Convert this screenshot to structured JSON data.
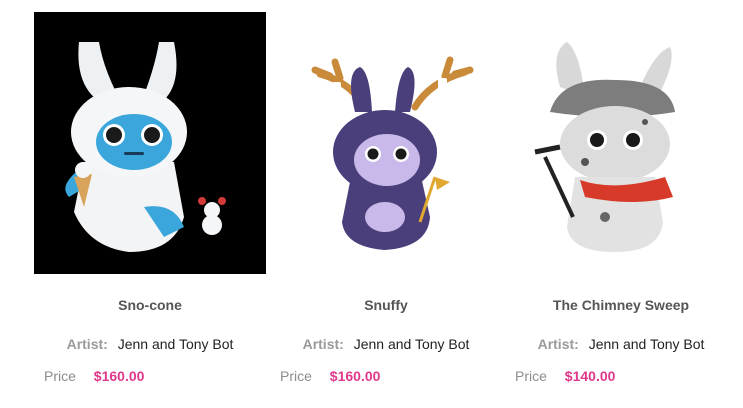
{
  "products": [
    {
      "name": "Sno-cone",
      "artist_label": "Artist:",
      "artist": "Jenn and Tony Bot",
      "price_label": "Price",
      "price": "$160.00"
    },
    {
      "name": "Snuffy",
      "artist_label": "Artist:",
      "artist": "Jenn and Tony Bot",
      "price_label": "Price",
      "price": "$160.00"
    },
    {
      "name": "The Chimney Sweep",
      "artist_label": "Artist:",
      "artist": "Jenn and Tony Bot",
      "price_label": "Price",
      "price": "$140.00"
    }
  ],
  "colors": {
    "price": "#e0388a",
    "title": "#555555",
    "label": "#9a9a9a"
  }
}
